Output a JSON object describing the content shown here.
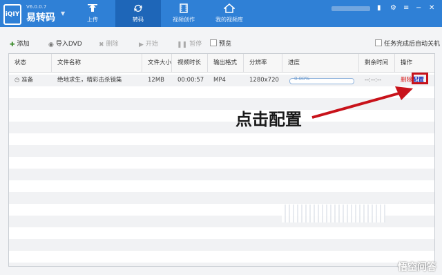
{
  "app": {
    "logo_text": "iQIY",
    "version": "V6.0.0.7",
    "name": "易转码"
  },
  "nav_tabs": [
    {
      "label": "上传",
      "icon": "upload-icon"
    },
    {
      "label": "转码",
      "icon": "refresh-icon"
    },
    {
      "label": "视频创作",
      "icon": "film-icon"
    },
    {
      "label": "我的视频库",
      "icon": "home-icon"
    }
  ],
  "toolbar": {
    "add": "添加",
    "import_dvd": "导入DVD",
    "delete": "删除",
    "start": "开始",
    "pause": "暂停",
    "preview": "预览",
    "auto_shutdown": "任务完成后自动关机"
  },
  "table": {
    "columns": [
      "状态",
      "文件名称",
      "文件大小",
      "视频时长",
      "输出格式",
      "分辨率",
      "进度",
      "剩余时间",
      "操作"
    ],
    "rows": [
      {
        "status": "准备",
        "filename": "绝地求生，精彩击杀镜集",
        "size": "12MB",
        "duration": "00:00:57",
        "format": "MP4",
        "resolution": "1280x720",
        "progress_text": "0.00%",
        "progress": 0,
        "remaining": "--:--:--",
        "action_delete": "删除",
        "action_config": "配置"
      }
    ]
  },
  "annotation": {
    "text": "点击配置"
  },
  "watermark": "悟空问答",
  "colors": {
    "titlebar": "#2f80d6",
    "active_tab": "#1e66b8",
    "highlight": "#c8121a"
  }
}
